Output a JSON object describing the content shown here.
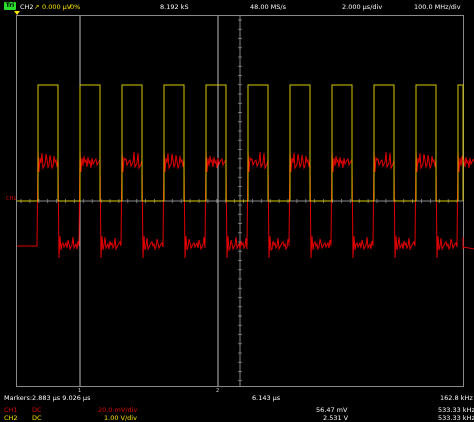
{
  "header": {
    "run_state": "Tri",
    "trigger_source": "CH2",
    "trigger_symbol": "↗",
    "trigger_level": "0.000 µV",
    "trigger_percent": "0%",
    "record_length": "8.192 kS",
    "sample_rate": "48.00 MS/s",
    "timebase": "2.000 µs/div",
    "bandwidth": "100.0 MHz/div"
  },
  "screen": {
    "ch_marker_label": "CH1",
    "cursor1_label": "1",
    "cursor2_label": "2"
  },
  "markers": {
    "label": "Markers:",
    "values": "2.883 µs  9.026 µs",
    "delta": "6.143 µs",
    "freq": "162.8 kHz"
  },
  "channels": [
    {
      "name": "CH1",
      "coupling": "DC",
      "scale": "20.0 mV/div",
      "measure": "56.47 mV",
      "freq": "533.33 kHz",
      "color": "#e00000"
    },
    {
      "name": "CH2",
      "coupling": "DC",
      "scale": "1.00 V/div",
      "measure": "2.531 V",
      "freq": "533.33 kHz",
      "color": "#ffe600"
    }
  ],
  "colors": {
    "ch1": "#e00000",
    "ch2": "#e0d000",
    "grid": "#6a6a6a",
    "cursor": "#bbbbbb"
  }
}
